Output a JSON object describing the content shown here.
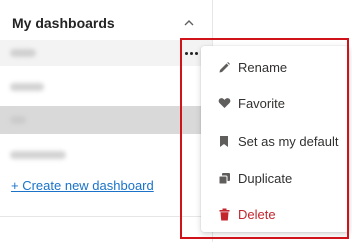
{
  "panel": {
    "title": "My dashboards",
    "create_link": "+ Create new dashboard"
  },
  "menu": {
    "items": [
      {
        "label": "Rename",
        "icon": "pencil-icon"
      },
      {
        "label": "Favorite",
        "icon": "heart-icon"
      },
      {
        "label": "Set as my default",
        "icon": "bookmark-icon"
      },
      {
        "label": "Duplicate",
        "icon": "duplicate-icon"
      },
      {
        "label": "Delete",
        "icon": "trash-icon"
      }
    ]
  },
  "colors": {
    "link": "#1a73c9",
    "danger": "#c4262e",
    "highlight": "#d0121b",
    "selected_row": "#d9d9d9"
  }
}
